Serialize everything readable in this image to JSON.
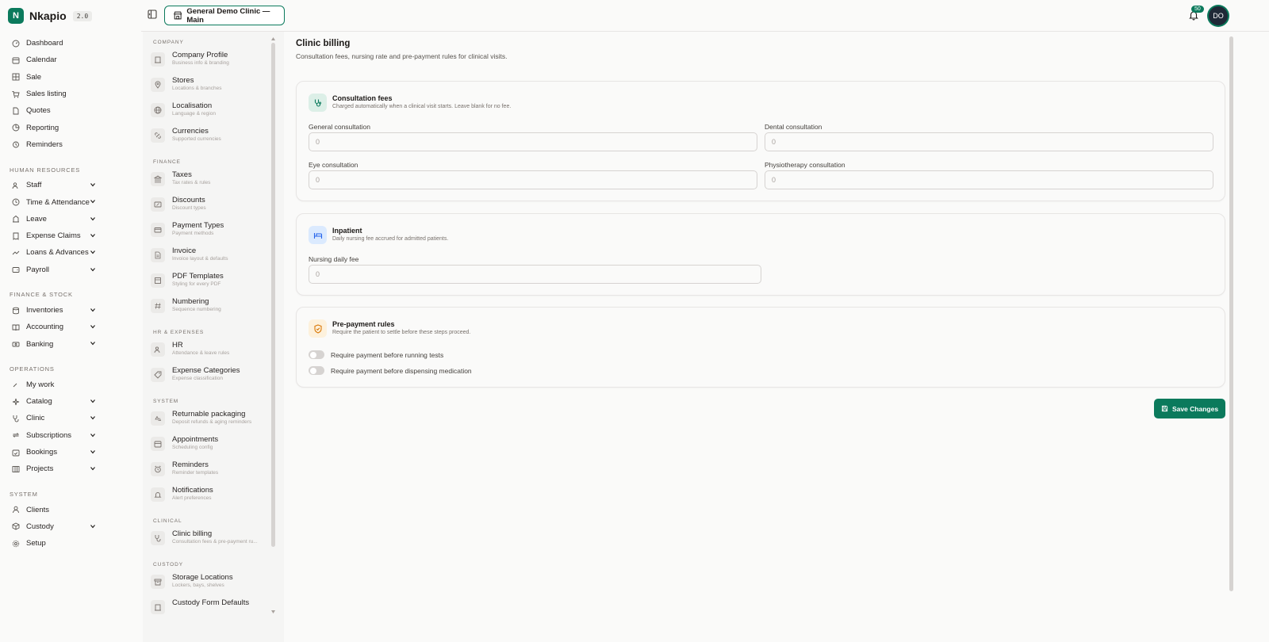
{
  "app": {
    "name": "Nkapio",
    "version": "2.0"
  },
  "topbar": {
    "clinic": "General Demo Clinic — Main",
    "notifications": "50",
    "avatar": "DO"
  },
  "nav": {
    "top": [
      {
        "label": "Dashboard",
        "icon": "gauge-icon"
      },
      {
        "label": "Calendar",
        "icon": "calendar-icon"
      },
      {
        "label": "Sale",
        "icon": "grid-icon"
      },
      {
        "label": "Sales listing",
        "icon": "cart-icon"
      },
      {
        "label": "Quotes",
        "icon": "file-icon"
      },
      {
        "label": "Reporting",
        "icon": "pie-icon"
      },
      {
        "label": "Reminders",
        "icon": "alarm-icon"
      }
    ],
    "hr_title": "HUMAN RESOURCES",
    "hr": [
      {
        "label": "Staff",
        "icon": "users-icon"
      },
      {
        "label": "Time & Attendance",
        "icon": "clock-icon"
      },
      {
        "label": "Leave",
        "icon": "leave-icon"
      },
      {
        "label": "Expense Claims",
        "icon": "receipt-icon"
      },
      {
        "label": "Loans & Advances",
        "icon": "loan-icon"
      },
      {
        "label": "Payroll",
        "icon": "wallet-icon"
      }
    ],
    "fin_title": "FINANCE & STOCK",
    "fin": [
      {
        "label": "Inventories",
        "icon": "database-icon"
      },
      {
        "label": "Accounting",
        "icon": "book-icon"
      },
      {
        "label": "Banking",
        "icon": "bank-icon"
      }
    ],
    "ops_title": "OPERATIONS",
    "ops": [
      {
        "label": "My work",
        "icon": "wrench-icon"
      },
      {
        "label": "Catalog",
        "icon": "sparkle-icon"
      },
      {
        "label": "Clinic",
        "icon": "stethoscope-icon"
      },
      {
        "label": "Subscriptions",
        "icon": "repeat-icon"
      },
      {
        "label": "Bookings",
        "icon": "calendar-check-icon"
      },
      {
        "label": "Projects",
        "icon": "columns-icon"
      }
    ],
    "sys_title": "SYSTEM",
    "sys": [
      {
        "label": "Clients",
        "icon": "user-icon"
      },
      {
        "label": "Custody",
        "icon": "package-icon"
      },
      {
        "label": "Setup",
        "icon": "gear-icon"
      }
    ]
  },
  "settings": {
    "company_title": "COMPANY",
    "company": [
      {
        "title": "Company Profile",
        "sub": "Business info & branding"
      },
      {
        "title": "Stores",
        "sub": "Locations & branches"
      },
      {
        "title": "Localisation",
        "sub": "Language & region"
      },
      {
        "title": "Currencies",
        "sub": "Supported currencies"
      }
    ],
    "finance_title": "FINANCE",
    "finance": [
      {
        "title": "Taxes",
        "sub": "Tax rates & rules"
      },
      {
        "title": "Discounts",
        "sub": "Discount types"
      },
      {
        "title": "Payment Types",
        "sub": "Payment methods"
      },
      {
        "title": "Invoice",
        "sub": "Invoice layout & defaults"
      },
      {
        "title": "PDF Templates",
        "sub": "Styling for every PDF"
      },
      {
        "title": "Numbering",
        "sub": "Sequence numbering"
      }
    ],
    "hr_title": "HR & EXPENSES",
    "hr": [
      {
        "title": "HR",
        "sub": "Attendance & leave rules"
      },
      {
        "title": "Expense Categories",
        "sub": "Expense classification"
      }
    ],
    "system_title": "SYSTEM",
    "system": [
      {
        "title": "Returnable packaging",
        "sub": "Deposit refunds & aging reminders"
      },
      {
        "title": "Appointments",
        "sub": "Scheduling config"
      },
      {
        "title": "Reminders",
        "sub": "Reminder templates"
      },
      {
        "title": "Notifications",
        "sub": "Alert preferences"
      }
    ],
    "clinical_title": "CLINICAL",
    "clinical": [
      {
        "title": "Clinic billing",
        "sub": "Consultation fees & pre-payment ru..."
      }
    ],
    "custody_title": "CUSTODY",
    "custody": [
      {
        "title": "Storage Locations",
        "sub": "Lockers, bays, shelves"
      },
      {
        "title": "Custody Form Defaults",
        "sub": ""
      }
    ]
  },
  "main": {
    "title": "Clinic billing",
    "subtitle": "Consultation fees, nursing rate and pre-payment rules for clinical visits.",
    "consultation": {
      "title": "Consultation fees",
      "sub": "Charged automatically when a clinical visit starts. Leave blank for no fee.",
      "general_label": "General consultation",
      "dental_label": "Dental consultation",
      "eye_label": "Eye consultation",
      "physio_label": "Physiotherapy consultation",
      "placeholder": "0"
    },
    "inpatient": {
      "title": "Inpatient",
      "sub": "Daily nursing fee accrued for admitted patients.",
      "nursing_label": "Nursing daily fee",
      "placeholder": "0"
    },
    "prepay": {
      "title": "Pre-payment rules",
      "sub": "Require the patient to settle before these steps proceed.",
      "tests_label": "Require payment before running tests",
      "meds_label": "Require payment before dispensing medication",
      "tests_on": false,
      "meds_on": false
    },
    "save_label": "Save Changes"
  },
  "colors": {
    "accent": "#0b7a5c",
    "amber": "#d97706"
  }
}
